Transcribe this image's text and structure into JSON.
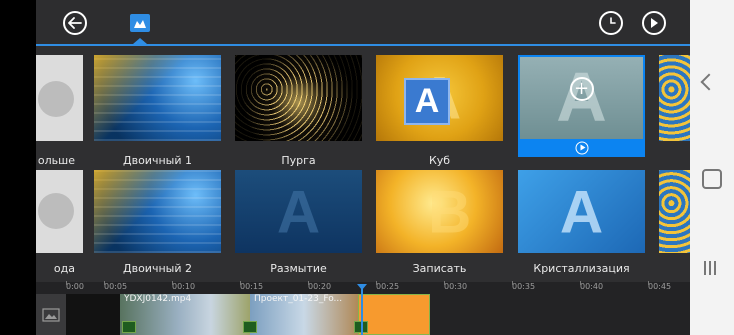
{
  "toolbar": {
    "back_icon": "back-arrow-icon",
    "tab_icon": "particle-effects-icon",
    "history_icon": "clock-icon",
    "play_icon": "play-icon"
  },
  "effects": [
    {
      "label": "ольше"
    },
    {
      "label": "Двоичный 1"
    },
    {
      "label": "Пурга"
    },
    {
      "label": "Куб"
    },
    {
      "label": "Двоичный 2"
    },
    {
      "label": "Размытие"
    },
    {
      "label": "Записать"
    },
    {
      "label": "Кристаллизация"
    },
    {
      "label": "ода"
    }
  ],
  "timeline": {
    "ticks": [
      "0:00",
      "00:05",
      "00:10",
      "00:15",
      "00:20",
      "00:25",
      "00:30",
      "00:35",
      "00:40",
      "00:45"
    ],
    "clips": [
      {
        "title": "YDXJ0142.mp4"
      },
      {
        "title": "Проект_01-23_Fo..."
      }
    ]
  },
  "colors": {
    "accent": "#2f8de4",
    "selected_bar": "#0c84f1",
    "background": "#2f2f31"
  }
}
